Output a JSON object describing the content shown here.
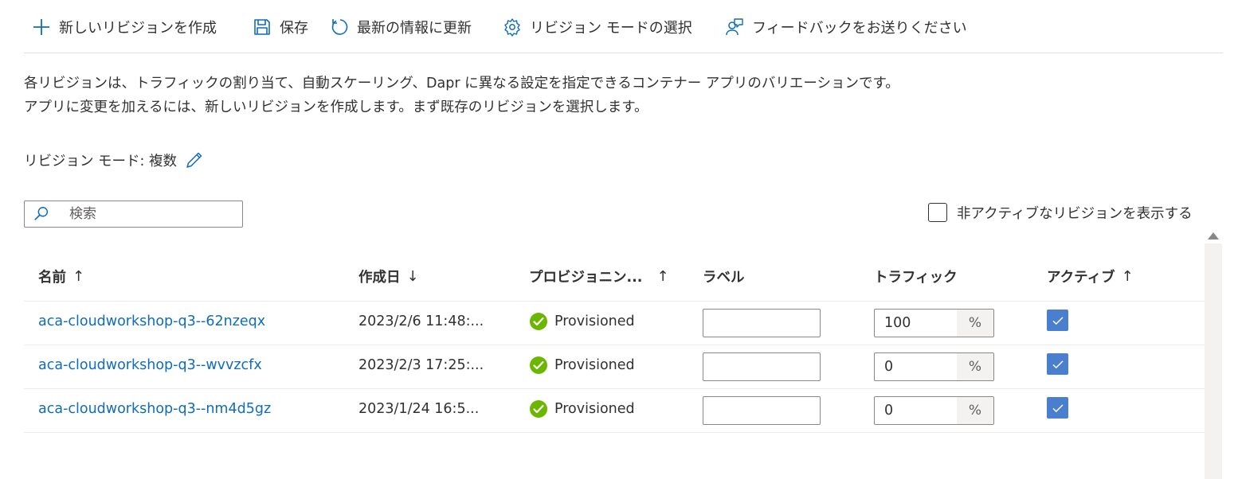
{
  "toolbar": {
    "new_revision": "新しいリビジョンを作成",
    "save": "保存",
    "refresh": "最新の情報に更新",
    "revision_mode": "リビジョン モードの選択",
    "feedback": "フィードバックをお送りください"
  },
  "description": {
    "line1": "各リビジョンは、トラフィックの割り当て、自動スケーリング、Dapr に異なる設定を指定できるコンテナー アプリのバリエーションです。",
    "line2": "アプリに変更を加えるには、新しいリビジョンを作成します。まず既存のリビジョンを選択します。"
  },
  "mode": {
    "label": "リビジョン モード: 複数"
  },
  "search": {
    "placeholder": "検索"
  },
  "inactive_toggle": {
    "label": "非アクティブなリビジョンを表示する",
    "checked": false
  },
  "columns": {
    "name": "名前",
    "name_sort": "↑",
    "created": "作成日",
    "created_sort": "↓",
    "provisioning": "プロビジョニン...",
    "provisioning_sort": "↑",
    "label": "ラベル",
    "traffic": "トラフィック",
    "active": "アクティブ",
    "active_sort": "↑"
  },
  "rows": [
    {
      "name": "aca-cloudworkshop-q3--62nzeqx",
      "created": "2023/2/6 11:48:...",
      "status": "Provisioned",
      "label": "",
      "traffic": "100",
      "unit": "%",
      "active": true
    },
    {
      "name": "aca-cloudworkshop-q3--wvvzcfx",
      "created": "2023/2/3 17:25:...",
      "status": "Provisioned",
      "label": "",
      "traffic": "0",
      "unit": "%",
      "active": true
    },
    {
      "name": "aca-cloudworkshop-q3--nm4d5gz",
      "created": "2023/1/24 16:5...",
      "status": "Provisioned",
      "label": "",
      "traffic": "0",
      "unit": "%",
      "active": true
    }
  ],
  "colors": {
    "accent": "#0f6cbd",
    "success": "#6bb700",
    "checkbox": "#4a7fd0"
  }
}
